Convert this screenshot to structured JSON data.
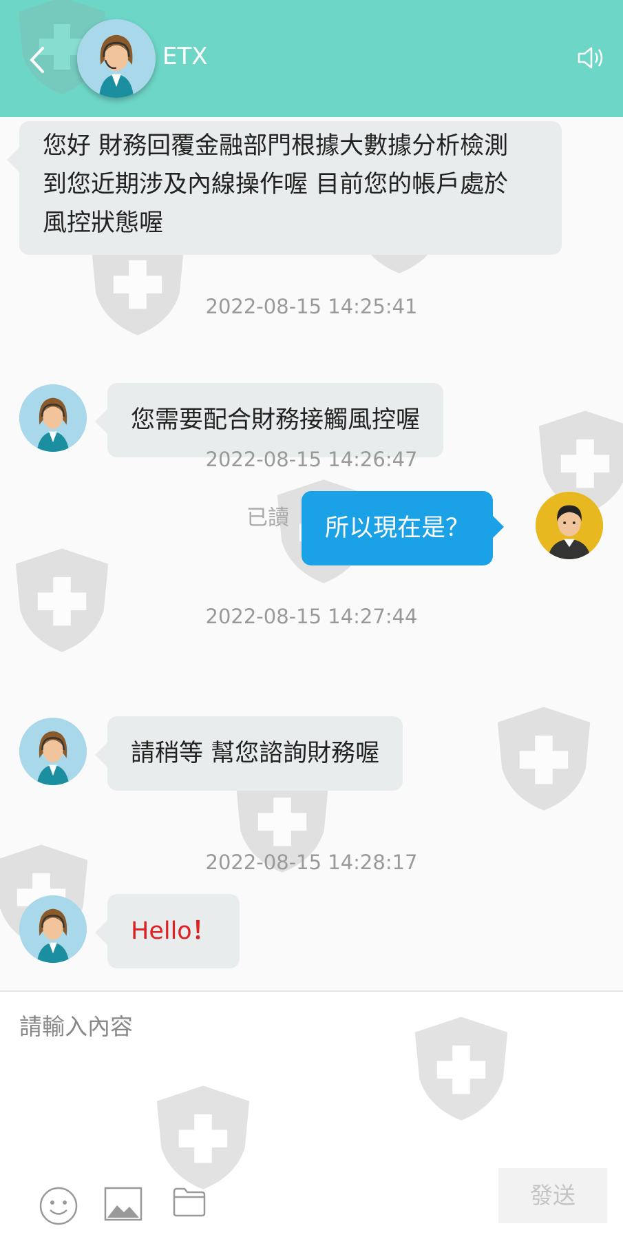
{
  "header": {
    "title": "ETX"
  },
  "messages": [
    {
      "text": "您好 財務回覆金融部門根據大數據分析檢測到您近期涉及內線操作喔 目前您的帳戶處於風控狀態喔"
    },
    {
      "timestamp": "2022-08-15 14:25:41",
      "text": "您需要配合財務接觸風控喔"
    },
    {
      "timestamp": "2022-08-15 14:26:47",
      "text": "所以現在是？",
      "status": "已讀"
    },
    {
      "timestamp": "2022-08-15 14:27:44",
      "text": "請稍等 幫您諮詢財務喔"
    },
    {
      "timestamp": "2022-08-15 14:28:17",
      "text": "Hello",
      "suffix": "！"
    }
  ],
  "composer": {
    "placeholder": "請輸入內容",
    "send_label": "發送"
  },
  "colors": {
    "header": "#6dd6c6",
    "outgoing_bubble": "#1ba1e6",
    "incoming_bubble": "#e8ecec",
    "hello_text": "#e02020"
  }
}
